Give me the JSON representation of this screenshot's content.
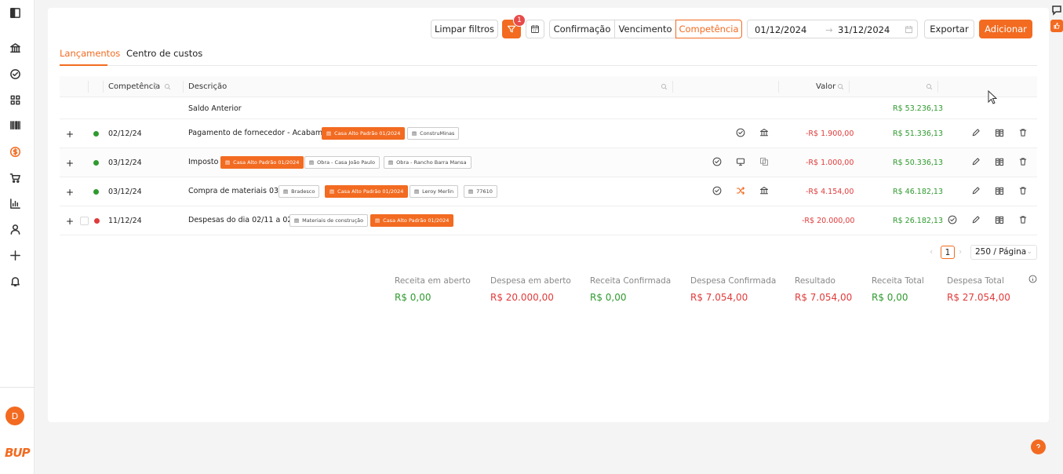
{
  "sidebar": {
    "icons": [
      "sidebar-toggle-icon",
      "bank-icon",
      "check-circle-icon",
      "grid-icon",
      "barcode-icon",
      "dollar-circle-icon",
      "cart-icon",
      "chart-icon",
      "user-icon",
      "plus-icon",
      "bell-icon"
    ],
    "avatar_letter": "D",
    "logo_text": "BUP"
  },
  "toolbar": {
    "clear_filters": "Limpar filtros",
    "filter_badge": "1",
    "segments": [
      "Confirmação",
      "Vencimento",
      "Competência"
    ],
    "active_segment": "Competência",
    "date_start": "01/12/2024",
    "date_end": "31/12/2024",
    "export": "Exportar",
    "add": "Adicionar"
  },
  "tabs": [
    "Lançamentos",
    "Centro de custos"
  ],
  "table": {
    "headers": {
      "competencia": "Competência",
      "descricao": "Descrição",
      "valor": "Valor"
    },
    "saldo_anterior": {
      "label": "Saldo Anterior",
      "saldo": "R$ 53.236,13"
    },
    "rows": [
      {
        "date": "02/12/24",
        "status": "green",
        "description": "Pagamento de fornecedor - Acabamento",
        "tags": [
          {
            "text": "Casa Alto Padrão 01/2024",
            "orange": true
          },
          {
            "text": "ConstruMinas",
            "orange": false
          }
        ],
        "value": "-R$ 1.900,00",
        "balance": "R$ 51.336,13"
      },
      {
        "date": "03/12/24",
        "status": "green",
        "description": "Imposto",
        "tags": [
          {
            "text": "Casa Alto Padrão 01/2024",
            "orange": true
          },
          {
            "text": "Obra - Casa João Paulo",
            "orange": false
          },
          {
            "text": "Obra - Rancho Barra Mansa",
            "orange": false
          }
        ],
        "value": "-R$ 1.000,00",
        "balance": "R$ 50.336,13"
      },
      {
        "date": "03/12/24",
        "status": "green",
        "description": "Compra de materiais 03/12",
        "tags": [
          {
            "text": "Bradesco",
            "orange": false
          },
          {
            "text": "Casa Alto Padrão 01/2024",
            "orange": true
          },
          {
            "text": "Leroy Merlin",
            "orange": false
          },
          {
            "text": "77610",
            "orange": false
          }
        ],
        "value": "-R$ 4.154,00",
        "balance": "R$ 46.182,13"
      },
      {
        "date": "11/12/24",
        "status": "red",
        "description": "Despesas do dia 02/11 a 02/12",
        "tags": [
          {
            "text": "Materiais de construção",
            "orange": false
          },
          {
            "text": "Casa Alto Padrão 01/2024",
            "orange": true
          }
        ],
        "value": "-R$ 20.000,00",
        "balance": "R$ 26.182,13"
      }
    ],
    "expand_symbol": "+"
  },
  "pagination": {
    "prev": "‹",
    "page": "1",
    "next": "›",
    "page_size": "250 / Página"
  },
  "summary": [
    {
      "label": "Receita em aberto",
      "value": "R$ 0,00",
      "color": "#2f9a2f"
    },
    {
      "label": "Despesa em aberto",
      "value": "R$ 20.000,00",
      "color": "#e03b3b"
    },
    {
      "label": "Receita Confirmada",
      "value": "R$ 0,00",
      "color": "#2f9a2f"
    },
    {
      "label": "Despesa Confirmada",
      "value": "R$ 7.054,00",
      "color": "#e03b3b"
    },
    {
      "label": "Resultado",
      "value": "R$ 7.054,00",
      "color": "#e03b3b"
    },
    {
      "label": "Receita Total",
      "value": "R$ 0,00",
      "color": "#2f9a2f"
    },
    {
      "label": "Despesa Total",
      "value": "R$ 27.054,00",
      "color": "#e03b3b"
    }
  ],
  "colors": {
    "accent": "#f26b21",
    "positive": "#2f9a2f",
    "negative": "#e03b3b"
  }
}
